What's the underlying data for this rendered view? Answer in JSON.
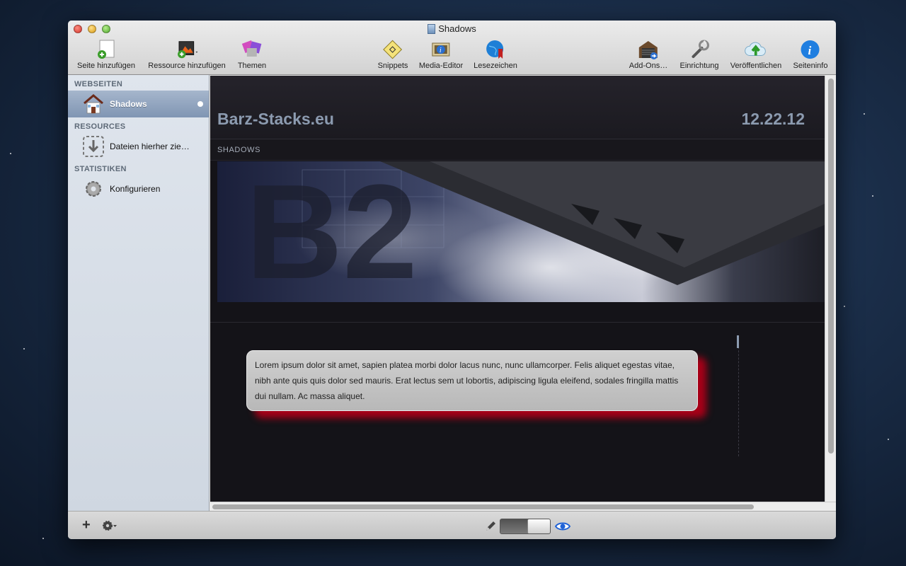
{
  "window": {
    "title": "Shadows"
  },
  "toolbar": {
    "items": [
      {
        "label": "Seite hinzufügen",
        "icon": "add-page-icon"
      },
      {
        "label": "Ressource hinzufügen",
        "icon": "add-resource-icon"
      },
      {
        "label": "Themen",
        "icon": "themes-icon"
      },
      {
        "label": "Snippets",
        "icon": "snippets-icon"
      },
      {
        "label": "Media-Editor",
        "icon": "media-editor-icon"
      },
      {
        "label": "Lesezeichen",
        "icon": "bookmarks-icon"
      },
      {
        "label": "Add-Ons…",
        "icon": "add-ons-icon"
      },
      {
        "label": "Einrichtung",
        "icon": "setup-icon"
      },
      {
        "label": "Veröffentlichen",
        "icon": "publish-icon"
      },
      {
        "label": "Seiteninfo",
        "icon": "page-info-icon"
      }
    ]
  },
  "sidebar": {
    "sections": [
      {
        "heading": "WEBSEITEN",
        "items": [
          {
            "label": "Shadows",
            "icon": "home-icon"
          }
        ]
      },
      {
        "heading": "RESOURCES",
        "items": [
          {
            "label": "Dateien hierher zie…",
            "icon": "drop-files-icon"
          }
        ]
      },
      {
        "heading": "STATISTIKEN",
        "items": [
          {
            "label": "Konfigurieren",
            "icon": "gear-icon"
          }
        ]
      }
    ]
  },
  "preview": {
    "site_title": "Barz-Stacks.eu",
    "date": "12.22.12",
    "nav_label": "SHADOWS",
    "body_text": "Lorem ipsum dolor sit amet, sapien platea morbi dolor lacus nunc, nunc ullamcorper. Felis aliquet egestas vitae, nibh ante quis quis dolor sed mauris. Erat lectus sem ut lobortis, adipiscing ligula eleifend, sodales fringilla mattis dui nullam. Ac massa aliquet.",
    "banner_text": "B2"
  },
  "bottombar": {
    "add": "+"
  }
}
